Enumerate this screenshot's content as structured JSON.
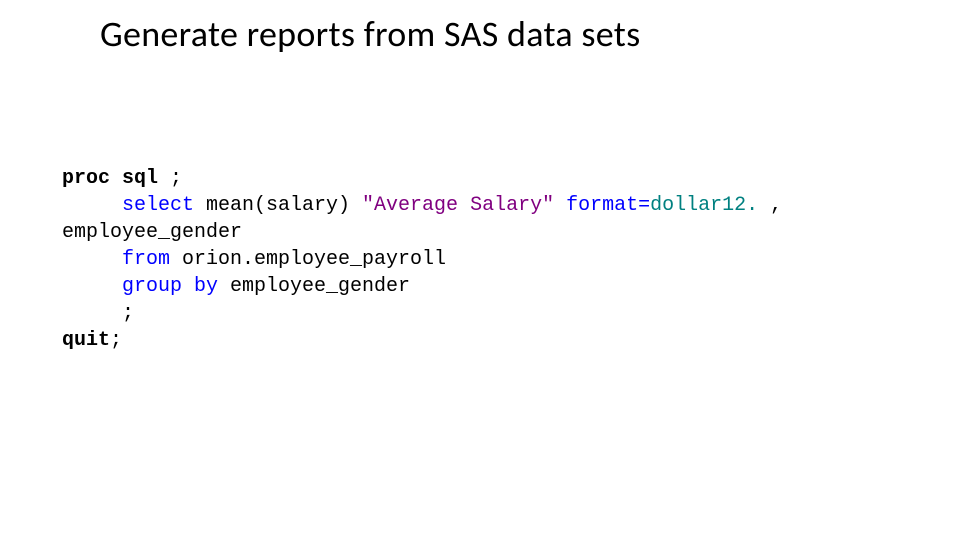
{
  "title": "Generate reports from SAS data sets",
  "code": {
    "l1_proc": "proc",
    "l1_sql": "sql",
    "l1_semi": " ;",
    "l2_select": "select",
    "l2_mean": " mean(salary) ",
    "l2_str": "\"Average Salary\"",
    "l2_format": " format=",
    "l2_dollar": "dollar12.",
    "l2_comma": " ,",
    "l3": "employee_gender",
    "l4_from": "from",
    "l4_rest": " orion.employee_payroll",
    "l5_group": "group by",
    "l5_rest": " employee_gender",
    "l6": ";",
    "l7_quit": "quit",
    "l7_semi": ";"
  }
}
